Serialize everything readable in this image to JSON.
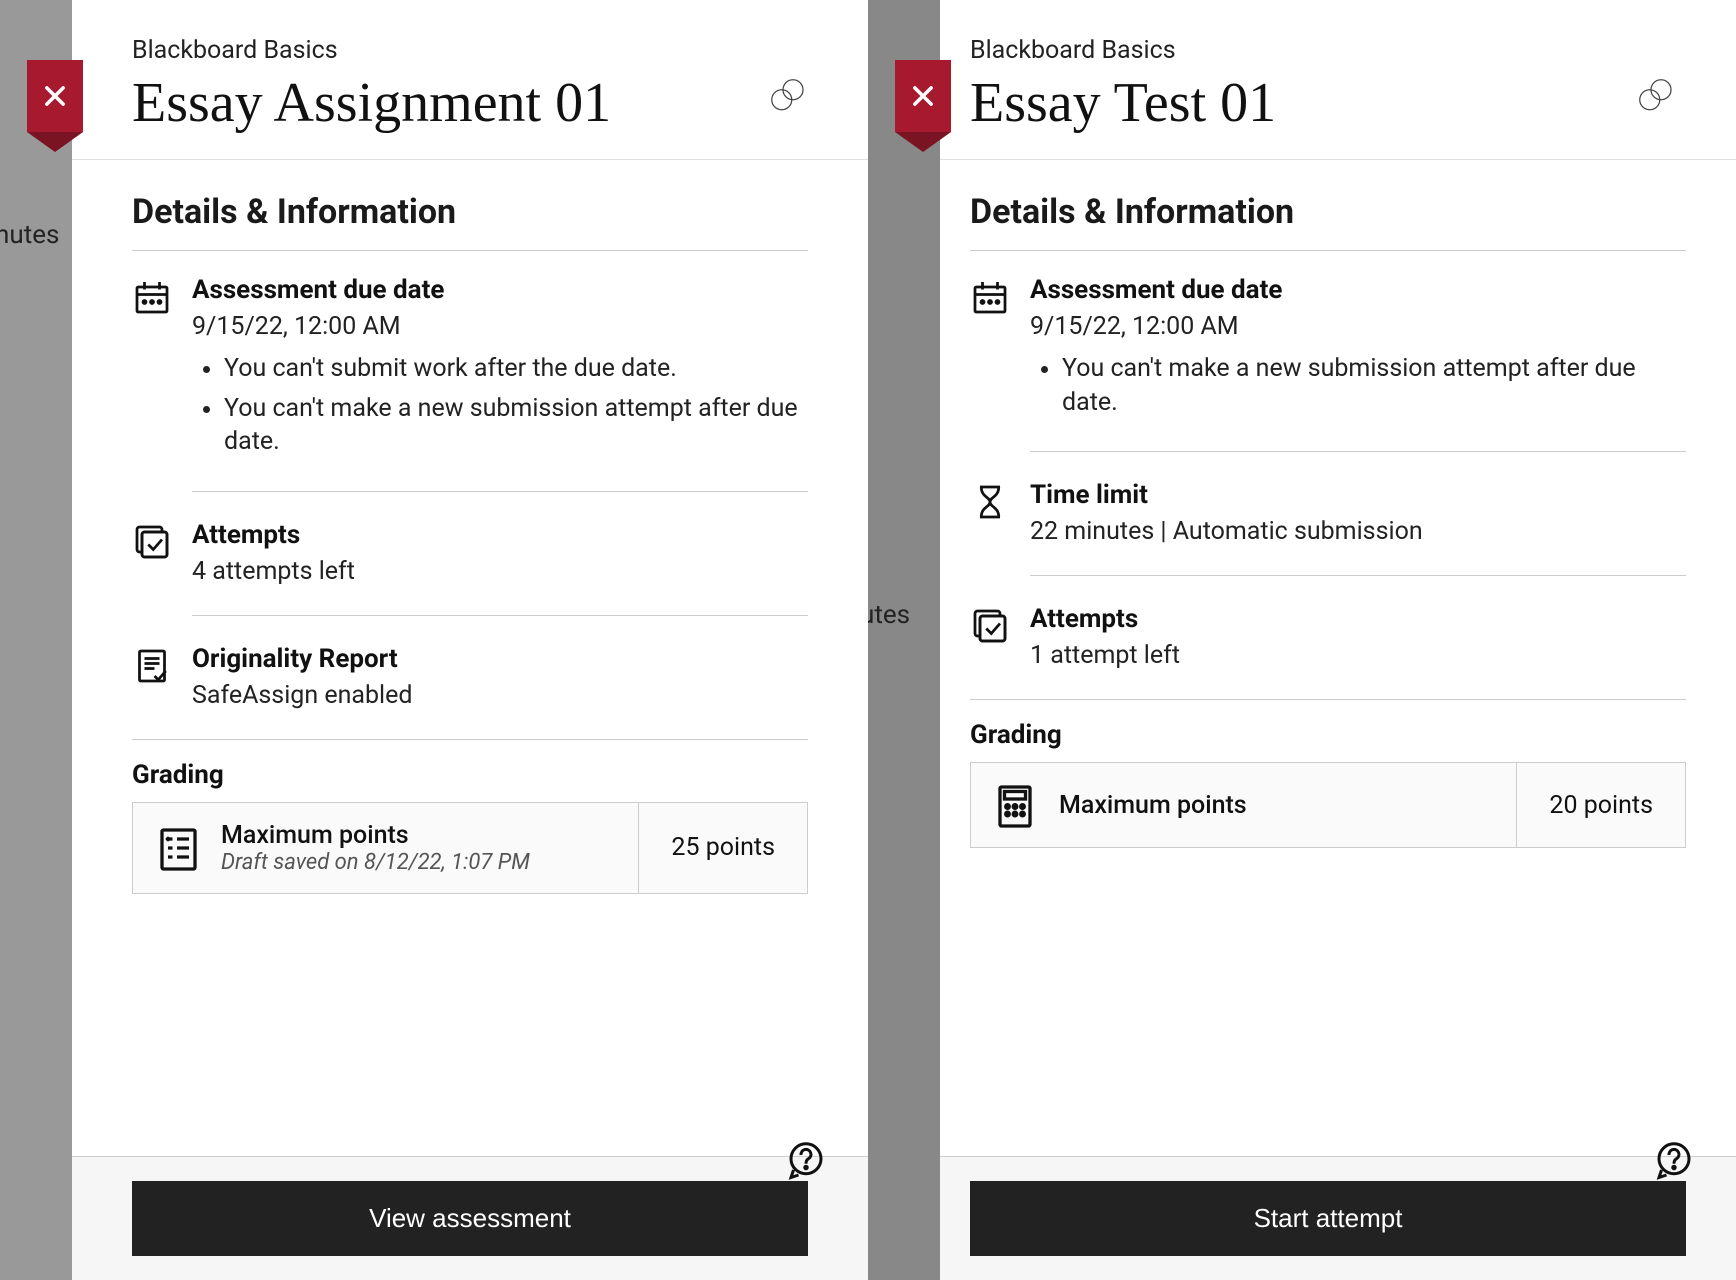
{
  "bg": {
    "left_text": "nutes",
    "mid_text": "utes"
  },
  "left": {
    "breadcrumb": "Blackboard Basics",
    "title": "Essay Assignment 01",
    "details_heading": "Details & Information",
    "due": {
      "label": "Assessment due date",
      "value": "9/15/22, 12:00 AM",
      "bullets": [
        "You can't submit work after the due date.",
        "You can't make a new submission attempt after due date."
      ]
    },
    "attempts": {
      "label": "Attempts",
      "value": "4 attempts left"
    },
    "originality": {
      "label": "Originality Report",
      "value": "SafeAssign enabled"
    },
    "grading": {
      "section_label": "Grading",
      "max_points_label": "Maximum points",
      "draft": "Draft saved on 8/12/22, 1:07 PM",
      "points": "25 points"
    },
    "button": "View assessment"
  },
  "right": {
    "breadcrumb": "Blackboard Basics",
    "title": "Essay Test 01",
    "details_heading": "Details & Information",
    "due": {
      "label": "Assessment due date",
      "value": "9/15/22, 12:00 AM",
      "bullets": [
        "You can't make a new submission attempt after due date."
      ]
    },
    "timelimit": {
      "label": "Time limit",
      "value": "22 minutes | Automatic submission"
    },
    "attempts": {
      "label": "Attempts",
      "value": "1 attempt left"
    },
    "grading": {
      "section_label": "Grading",
      "max_points_label": "Maximum points",
      "points": "20 points"
    },
    "button": "Start attempt"
  }
}
